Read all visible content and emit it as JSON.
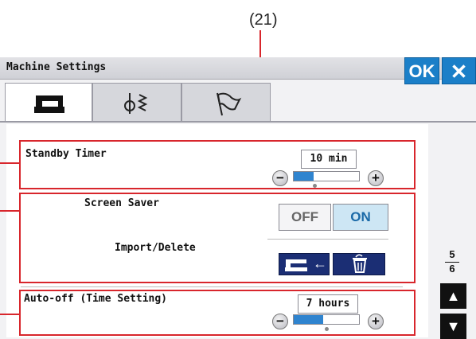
{
  "callout": {
    "label": "(21)"
  },
  "header": {
    "title": "Machine Settings",
    "ok_label": "OK",
    "close_glyph": "✕"
  },
  "tabs": [
    {
      "name": "machine",
      "icon": "sewing-machine-icon",
      "active": true
    },
    {
      "name": "stitch",
      "icon": "needle-zigzag-icon",
      "active": false
    },
    {
      "name": "language",
      "icon": "flag-icon",
      "active": false
    }
  ],
  "settings": {
    "standby_timer": {
      "label": "Standby Timer",
      "value": "10 min",
      "level": 0.3,
      "minus": "−",
      "plus": "+"
    },
    "screen_saver": {
      "label": "Screen Saver",
      "off_label": "OFF",
      "on_label": "ON",
      "selected": "ON"
    },
    "import_delete": {
      "label": "Import/Delete",
      "import_glyph": "←"
    },
    "auto_off": {
      "label": "Auto-off (Time Setting)",
      "value": "7 hours",
      "level": 0.45,
      "minus": "−",
      "plus": "+"
    }
  },
  "pager": {
    "current": "5",
    "total": "6",
    "up_glyph": "▲",
    "down_glyph": "▼"
  },
  "colors": {
    "accent": "#1b7fc8",
    "callout": "#d8262c",
    "dark_button": "#1b2e74",
    "slider_fill": "#2f84cf"
  }
}
